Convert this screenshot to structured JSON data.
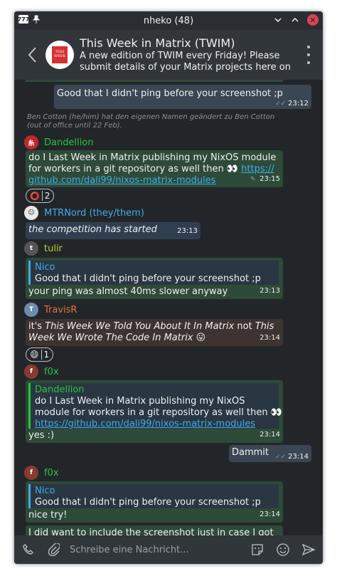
{
  "window": {
    "title": "nheko (48)",
    "app_icon_text": "777"
  },
  "room": {
    "name": "This Week in Matrix (TWIM)",
    "topic_line1": "A new edition of TWIM every Friday! Please",
    "topic_line2": "submit details of your Matrix projects here on",
    "avatar_text": "THIS WEEK"
  },
  "timeline": {
    "m1": {
      "text": "Good that I didn't ping before your screenshot ;p",
      "time": "23:12"
    },
    "state_event": "Ben Cotton (he/him) hat den eigenen Namen geändert zu Ben Cotton (out of office until 22 Feb).",
    "m2": {
      "sender": "Dandellion",
      "line1": "do I Last Week in Matrix publishing my NixOS module",
      "line2_prefix": "for workers in a git repository as well then 👀 ",
      "link1": "https://",
      "link2": "github.com/dali99/nixos-matrix-modules",
      "time": "23:15",
      "reaction_emoji": "⭕",
      "reaction_count": "2"
    },
    "m3": {
      "sender": "MTRNord (they/them)",
      "text": "the competition has started",
      "time": "23:13"
    },
    "m4": {
      "sender": "tulir",
      "quote_name": "Nico",
      "quote_text": "Good that I didn't ping before your screenshot ;p",
      "text": "your ping was almost 40ms slower anyway",
      "time": "23:13"
    },
    "m5": {
      "sender": "TravisR",
      "p1": "it's ",
      "i1": "This Week We Told You About It In Matrix",
      "p2": " not ",
      "i2a": "This",
      "i2b": "Week We Wrote The Code In Matrix",
      "emoji": " 😛",
      "time": "23:14",
      "reaction_emoji": "😄",
      "reaction_count": "1"
    },
    "m6": {
      "sender": "f0x",
      "quote_name": "Dandellion",
      "quote_l1": "do I Last Week in Matrix publishing my NixOS",
      "quote_l2": "module for workers in a git repository as well then 👀",
      "quote_link": "https://github.com/dali99/nixos-matrix-modules",
      "text": "yes :)",
      "time": "23:14"
    },
    "m7": {
      "text": "Dammit",
      "time": "23:14"
    },
    "m8": {
      "sender": "f0x",
      "quote_name": "Nico",
      "quote_text": "Good that I didn't ping before your screenshot ;p",
      "text": "nice try!",
      "time": "23:14",
      "next_partial": "I did want to include the screenshot just in case I got"
    }
  },
  "composer": {
    "placeholder": "Schreibe eine Nachricht..."
  },
  "colors": {
    "dandellion": "#27c63a",
    "mtrnord": "#3daee9",
    "tulir": "#b5d334",
    "travisr": "#e2733c",
    "f0x": "#27c63a"
  }
}
